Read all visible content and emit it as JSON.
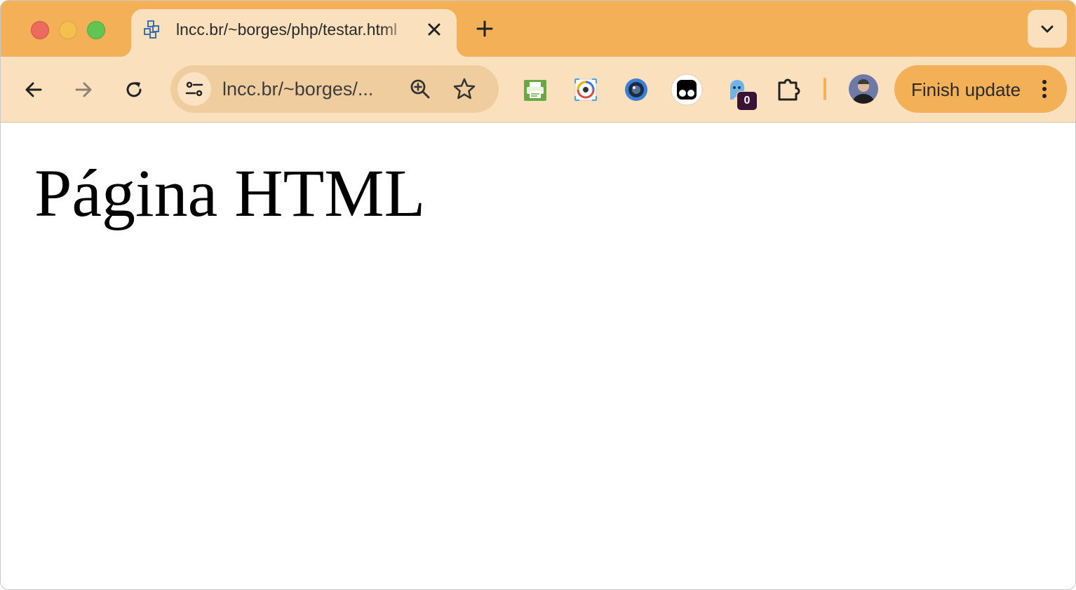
{
  "window": {
    "traffic_lights": [
      "close",
      "minimize",
      "zoom"
    ]
  },
  "tab": {
    "title": "lncc.br/~borges/php/testar.html",
    "favicon": "globe-network-icon",
    "close_icon": "close-icon"
  },
  "tab_strip": {
    "new_tab_icon": "plus-icon",
    "tab_list_icon": "chevron-down-icon"
  },
  "toolbar": {
    "back_icon": "arrow-left-icon",
    "forward_icon": "arrow-right-icon",
    "reload_icon": "reload-icon",
    "omnibox": {
      "site_info_icon": "tune-icon",
      "url": "lncc.br/~borges/...",
      "zoom_icon": "zoom-in-icon",
      "bookmark_icon": "star-icon"
    },
    "extensions": [
      {
        "name": "printer-extension-icon"
      },
      {
        "name": "color-picker-extension-icon"
      },
      {
        "name": "lens-extension-icon"
      },
      {
        "name": "tampermonkey-extension-icon"
      },
      {
        "name": "ghost-extension-icon",
        "badge": "0"
      },
      {
        "name": "puzzle-extensions-icon"
      }
    ],
    "finish_update_label": "Finish update",
    "menu_icon": "kebab-menu-icon"
  },
  "colors": {
    "tab_strip": "#f3b057",
    "toolbar": "#fbe0bd",
    "omnibox": "#f0cd9e",
    "update_button": "#f3b057"
  },
  "page": {
    "heading": "Página HTML"
  }
}
